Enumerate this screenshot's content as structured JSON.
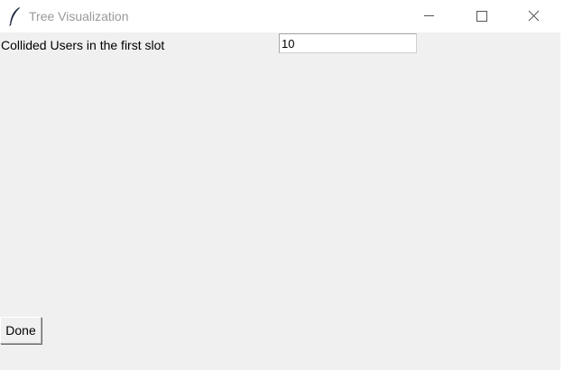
{
  "window": {
    "title": "Tree Visualization",
    "app_icon": "feather-icon"
  },
  "controls": {
    "minimize_icon": "minimize-icon",
    "maximize_icon": "maximize-icon",
    "close_icon": "close-icon"
  },
  "form": {
    "collided_label": "Collided Users in the first slot",
    "collided_value": "10",
    "done_label": "Done"
  }
}
